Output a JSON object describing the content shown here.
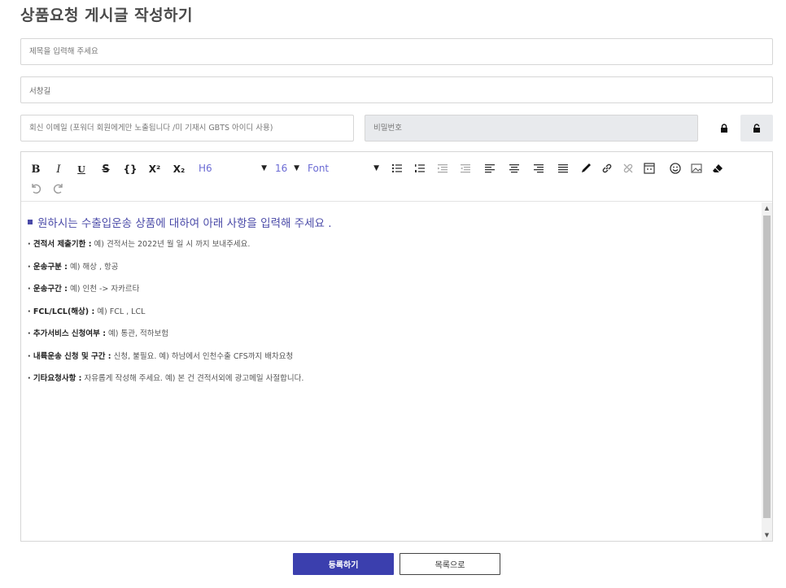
{
  "page": {
    "title": "상품요청 게시글 작성하기"
  },
  "form": {
    "title_placeholder": "제목을 입력해 주세요",
    "author_value": "서창길",
    "email_placeholder": "회신 이메일 (포워더 회원에게만 노출됩니다 /미 기재시 GBTS 아이디 사용)",
    "password_placeholder": "비밀번호"
  },
  "toolbar": {
    "bold": "B",
    "italic": "I",
    "underline": "U",
    "strike": "S",
    "code": "{}",
    "superscript": "X²",
    "subscript": "X₂",
    "heading": "H6",
    "size": "16",
    "font": "Font"
  },
  "content": {
    "heading": "원하시는 수출입운송 상품에 대하여 아래 사항을 입력해 주세요 .",
    "lines": [
      {
        "label": "· 견적서 제출기한 :",
        "text": " 예) 견적서는 2022년  월  일   시 까지 보내주세요."
      },
      {
        "label": "· 운송구분 :",
        "text": " 예) 해상 , 항공"
      },
      {
        "label": "· 운송구간 :",
        "text": "  예) 인천 -> 자카르타"
      },
      {
        "label": "· FCL/LCL(해상) :",
        "text": " 예) FCL , LCL"
      },
      {
        "label": "· 추가서비스 신청여부 :",
        "text": " 예) 통관, 적하보험"
      },
      {
        "label": "· 내륙운송 신청 및 구간 :",
        "text": " 신청, 불필요.  예) 하남에서 인천수출 CFS까지 배차요청"
      },
      {
        "label": "· 기타요청사항 :",
        "text": "  자유롭게 작성해 주세요.  예) 본 건 견적서외에 광고메일 사절합니다."
      }
    ]
  },
  "buttons": {
    "submit": "등록하기",
    "list": "목록으로"
  },
  "colors": {
    "accent": "#3b3fae",
    "heading": "#4a4aa8",
    "select_text": "#6b6bd4"
  }
}
